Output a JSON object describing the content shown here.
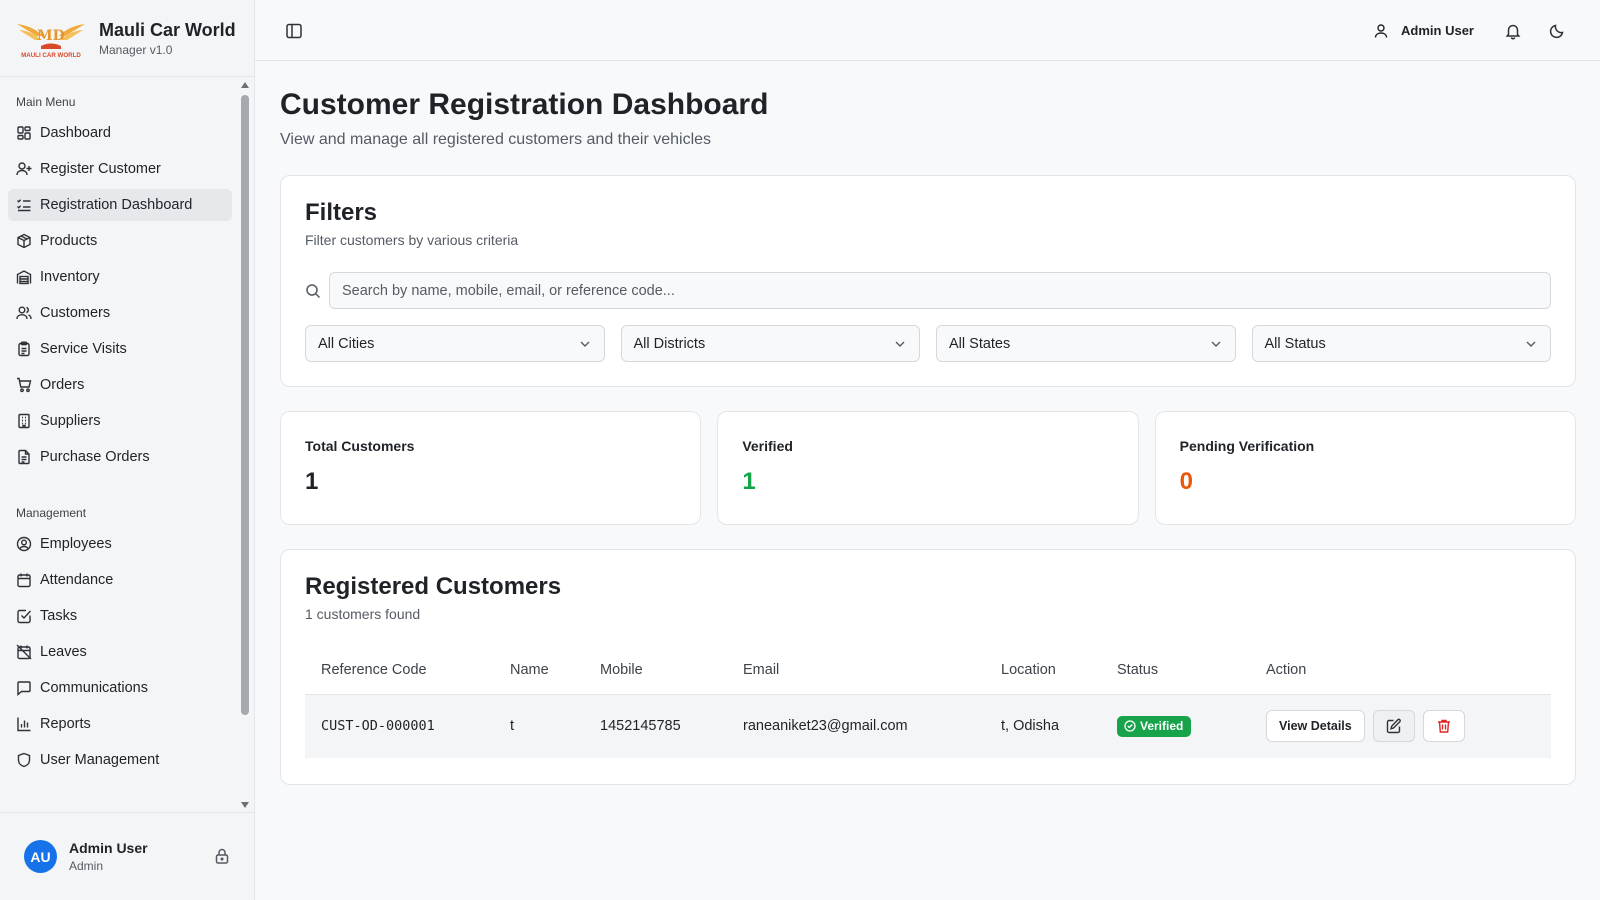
{
  "brand": {
    "name": "Mauli Car World",
    "version": "Manager v1.0",
    "logo_text": "MAULI CAR WORLD"
  },
  "sidebar": {
    "section_main": "Main Menu",
    "main_items": [
      {
        "label": "Dashboard",
        "icon": "grid-icon"
      },
      {
        "label": "Register Customer",
        "icon": "user-plus-icon"
      },
      {
        "label": "Registration Dashboard",
        "icon": "list-checks-icon",
        "active": true
      },
      {
        "label": "Products",
        "icon": "package-icon"
      },
      {
        "label": "Inventory",
        "icon": "warehouse-icon"
      },
      {
        "label": "Customers",
        "icon": "users-icon"
      },
      {
        "label": "Service Visits",
        "icon": "clipboard-icon"
      },
      {
        "label": "Orders",
        "icon": "cart-icon"
      },
      {
        "label": "Suppliers",
        "icon": "building-icon"
      },
      {
        "label": "Purchase Orders",
        "icon": "file-text-icon"
      }
    ],
    "section_management": "Management",
    "management_items": [
      {
        "label": "Employees",
        "icon": "user-circle-icon"
      },
      {
        "label": "Attendance",
        "icon": "calendar-icon"
      },
      {
        "label": "Tasks",
        "icon": "check-square-icon"
      },
      {
        "label": "Leaves",
        "icon": "calendar-off-icon"
      },
      {
        "label": "Communications",
        "icon": "message-icon"
      },
      {
        "label": "Reports",
        "icon": "bar-chart-icon"
      },
      {
        "label": "User Management",
        "icon": "shield-icon"
      }
    ],
    "footer": {
      "initials": "AU",
      "name": "Admin User",
      "role": "Admin"
    }
  },
  "topbar": {
    "user_label": "Admin User"
  },
  "page": {
    "title": "Customer Registration Dashboard",
    "subtitle": "View and manage all registered customers and their vehicles"
  },
  "filters": {
    "title": "Filters",
    "subtitle": "Filter customers by various criteria",
    "search_placeholder": "Search by name, mobile, email, or reference code...",
    "search_value": "",
    "city": "All Cities",
    "district": "All Districts",
    "state": "All States",
    "status": "All Status"
  },
  "stats": {
    "total_label": "Total Customers",
    "total_value": "1",
    "verified_label": "Verified",
    "verified_value": "1",
    "pending_label": "Pending Verification",
    "pending_value": "0"
  },
  "customers": {
    "title": "Registered Customers",
    "count_text": "1 customers found",
    "columns": [
      "Reference Code",
      "Name",
      "Mobile",
      "Email",
      "Location",
      "Status",
      "Action"
    ],
    "rows": [
      {
        "ref": "CUST-OD-000001",
        "name": "t",
        "mobile": "1452145785",
        "email": "raneaniket23@gmail.com",
        "location": "t, Odisha",
        "status": "Verified",
        "view_label": "View Details"
      }
    ]
  },
  "colors": {
    "accent": "#1572e8",
    "verified": "#16a34a",
    "pending": "#ea580c",
    "danger": "#dc2626"
  }
}
